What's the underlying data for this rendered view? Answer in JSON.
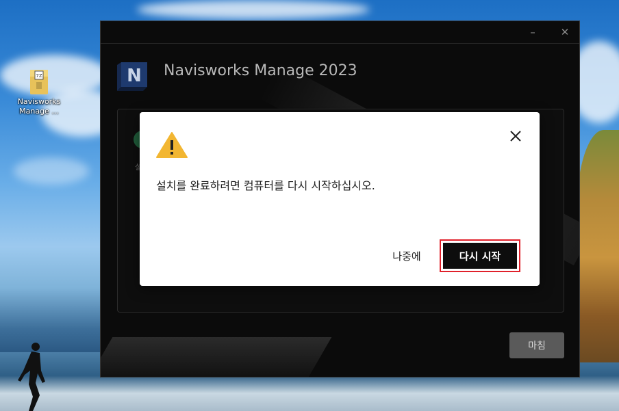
{
  "desktop": {
    "icon_label_line1": "Navisworks",
    "icon_label_line2": "Manage ..."
  },
  "window": {
    "minimize_glyph": "–",
    "close_glyph": "✕",
    "logo_letter": "N",
    "app_title": "Navisworks Manage 2023",
    "finish_label": "마침",
    "brand_color": "#1e3a6e"
  },
  "dialog": {
    "message": "설치를 완료하려면 컴퓨터를 다시 시작하십시오.",
    "later_label": "나중에",
    "restart_label": "다시 시작",
    "warning_color": "#f2b632",
    "highlight_color": "#e0202a"
  }
}
